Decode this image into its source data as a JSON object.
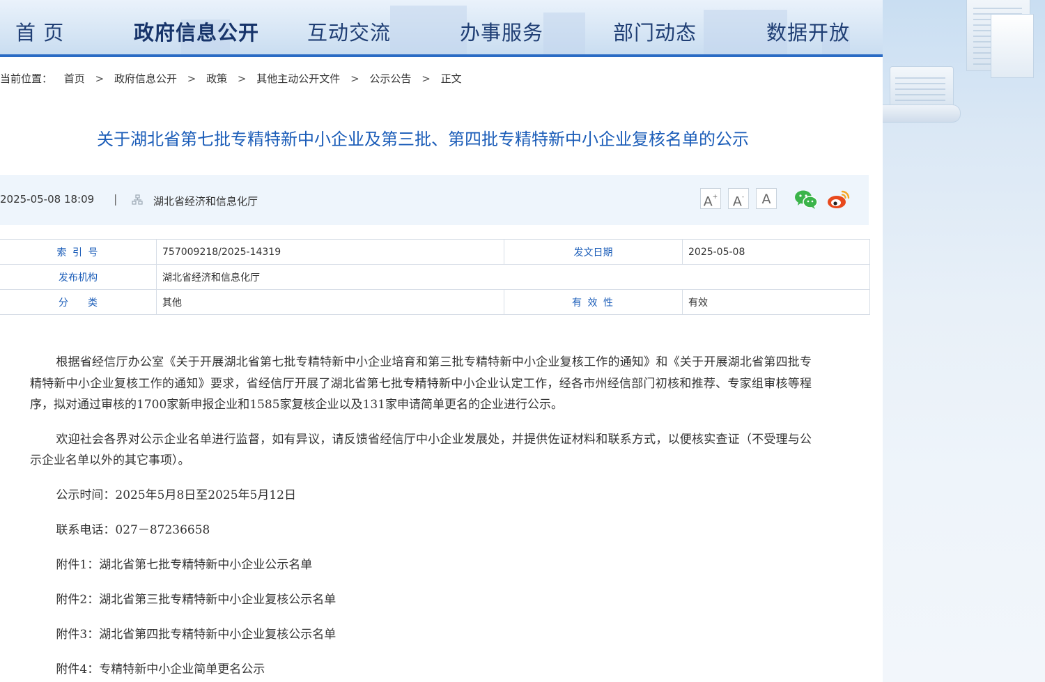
{
  "nav": {
    "items": [
      {
        "label": "首 页"
      },
      {
        "label": "政府信息公开"
      },
      {
        "label": "互动交流"
      },
      {
        "label": "办事服务"
      },
      {
        "label": "部门动态"
      },
      {
        "label": "数据开放"
      }
    ],
    "active_index": 1
  },
  "breadcrumb": {
    "prefix": "当前位置：",
    "separator": ">",
    "items": [
      "首页",
      "政府信息公开",
      "政策",
      "其他主动公开文件",
      "公示公告",
      "正文"
    ]
  },
  "article": {
    "title": "关于湖北省第七批专精特新中小企业及第三批、第四批专精特新中小企业复核名单的公示",
    "date": "2025-05-08 18:09",
    "meta_sep": "|",
    "source": "湖北省经济和信息化厅"
  },
  "toolbar": {
    "font_large": "A",
    "font_large_sup": "+",
    "font_small": "A",
    "font_small_sup": "-",
    "font_reset": "A",
    "share_icons": [
      "wechat-icon",
      "weibo-icon"
    ],
    "colors": {
      "wechat": "#3bb44a",
      "weibo": "#e8491d"
    }
  },
  "info": {
    "index_label": "索 引 号",
    "index_value": "757009218/2025-14319",
    "date_label": "发文日期",
    "date_value": "2025-05-08",
    "org_label": "发布机构",
    "org_value": "湖北省经济和信息化厅",
    "category_label": "分　　类",
    "category_value": "其他",
    "validity_label": "有 效 性",
    "validity_value": "有效"
  },
  "content": {
    "paragraphs": [
      "根据省经信厅办公室《关于开展湖北省第七批专精特新中小企业培育和第三批专精特新中小企业复核工作的通知》和《关于开展湖北省第四批专精特新中小企业复核工作的通知》要求，省经信厅开展了湖北省第七批专精特新中小企业认定工作，经各市州经信部门初核和推荐、专家组审核等程序，拟对通过审核的1700家新申报企业和1585家复核企业以及131家申请简单更名的企业进行公示。",
      "欢迎社会各界对公示企业名单进行监督，如有异议，请反馈省经信厅中小企业发展处，并提供佐证材料和联系方式，以便核实查证（不受理与公示企业名单以外的其它事项）。",
      "公示时间：2025年5月8日至2025年5月12日",
      "联系电话：027－87236658",
      "附件1：湖北省第七批专精特新中小企业公示名单",
      "附件2：湖北省第三批专精特新中小企业复核公示名单",
      "附件3：湖北省第四批专精特新中小企业复核公示名单",
      "附件4：专精特新中小企业简单更名公示"
    ]
  },
  "theme": {
    "nav_bar": "#2a6bc4",
    "title_color": "#1a5cb8",
    "meta_bg": "#eef5fc"
  }
}
